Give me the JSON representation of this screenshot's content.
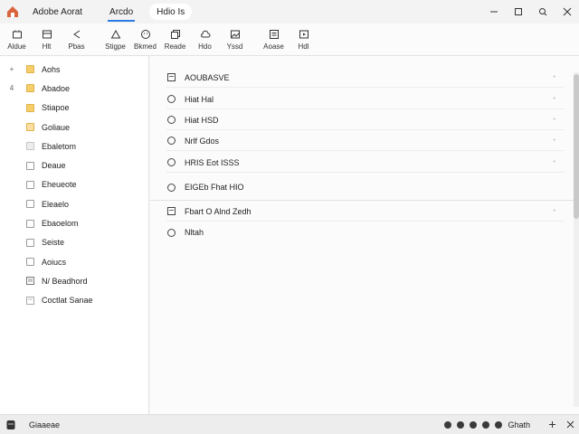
{
  "titlebar": {
    "app_title": "Adobe Aorat",
    "tab_active": "Arcdo",
    "tab_other": "Hdio Is"
  },
  "toolbar": {
    "items": [
      {
        "label": "Aldue",
        "icon": "home-icon"
      },
      {
        "label": "Hlt",
        "icon": "window-icon"
      },
      {
        "label": "Pbas",
        "icon": "back-arrow-icon"
      },
      {
        "label": "Stigpe",
        "icon": "triangle-icon"
      },
      {
        "label": "Bkmed",
        "icon": "smiley-icon"
      },
      {
        "label": "Reade",
        "icon": "copy-icon"
      },
      {
        "label": "Hdo",
        "icon": "cloud-icon"
      },
      {
        "label": "Yssd",
        "icon": "image-icon"
      },
      {
        "label": "Aoase",
        "icon": "list-icon"
      },
      {
        "label": "Hdl",
        "icon": "video-icon"
      }
    ]
  },
  "sidebar": {
    "items": [
      {
        "label": "Aohs",
        "icon": "folder",
        "expander": "+"
      },
      {
        "label": "Abadoe",
        "icon": "folder",
        "expander": "4"
      },
      {
        "label": "Stiapoe",
        "icon": "folder",
        "expander": ""
      },
      {
        "label": "Goliaue",
        "icon": "folder-light",
        "expander": ""
      },
      {
        "label": "Ebaletom",
        "icon": "checkbox-disabled",
        "expander": ""
      },
      {
        "label": "Deaue",
        "icon": "checkbox",
        "expander": ""
      },
      {
        "label": "Eheueote",
        "icon": "checkbox",
        "expander": ""
      },
      {
        "label": "Eleaelo",
        "icon": "checkbox",
        "expander": ""
      },
      {
        "label": "Ebaoelom",
        "icon": "checkbox",
        "expander": ""
      },
      {
        "label": "Seiste",
        "icon": "checkbox",
        "expander": ""
      },
      {
        "label": "Aoiucs",
        "icon": "checkbox",
        "expander": ""
      },
      {
        "label": "N/ Beadhord",
        "icon": "doc-icon",
        "expander": ""
      },
      {
        "label": "Coctlat Sanae",
        "icon": "page-icon",
        "expander": ""
      }
    ]
  },
  "main": {
    "rows": [
      {
        "label": "AOUBASVE",
        "icon": "doc-icon"
      },
      {
        "label": "Hiat Hal",
        "icon": "radio"
      },
      {
        "label": "Hiat HSD",
        "icon": "radio"
      },
      {
        "label": "Nrlf Gdos",
        "icon": "radio"
      },
      {
        "label": "HRIS Eot ISSS",
        "icon": "radio"
      },
      {
        "label": "EIGEb Fhat HIO",
        "icon": "radio"
      },
      {
        "label": "Fbart O Alnd Zedh",
        "icon": "doc-icon"
      },
      {
        "label": "Nltah",
        "icon": "radio"
      }
    ]
  },
  "statusbar": {
    "text": "Giaaeae",
    "right_label": "Ghath"
  }
}
